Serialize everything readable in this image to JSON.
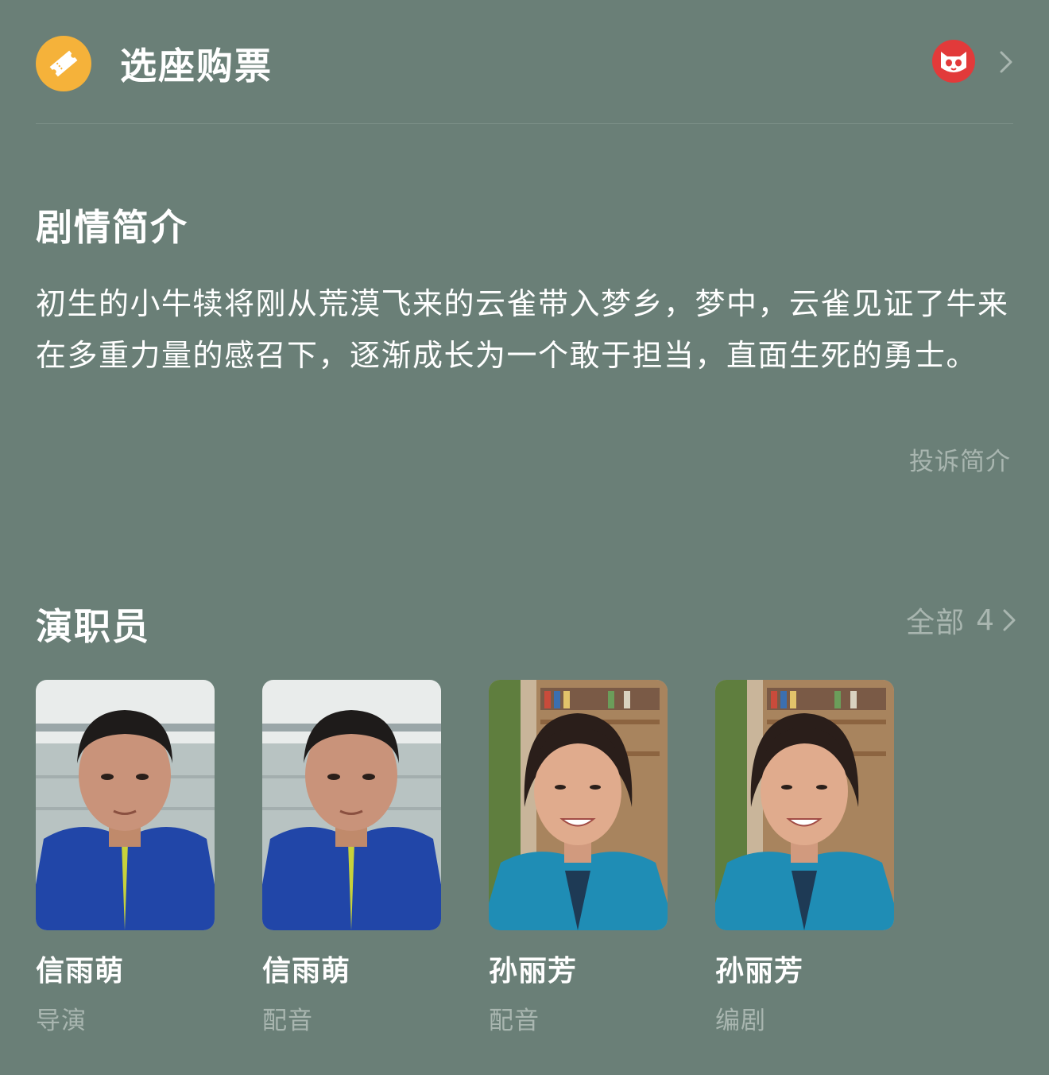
{
  "ticket": {
    "title": "选座购票",
    "icon": "ticket-icon",
    "provider_icon": "maoyan-cat-logo",
    "chevron_icon": "chevron-right-icon",
    "accent_color": "#f5b23a"
  },
  "synopsis": {
    "title": "剧情简介",
    "text": "初生的小牛犊将刚从荒漠飞来的云雀带入梦乡，梦中，云雀见证了牛来在多重力量的感召下，逐渐成长为一个敢于担当，直面生死的勇士。",
    "report_label": "投诉简介"
  },
  "cast": {
    "title": "演职员",
    "all_label": "全部",
    "all_count": "4",
    "members": [
      {
        "name": "信雨萌",
        "role": "导演"
      },
      {
        "name": "信雨萌",
        "role": "配音"
      },
      {
        "name": "孙丽芳",
        "role": "配音"
      },
      {
        "name": "孙丽芳",
        "role": "编剧"
      }
    ]
  }
}
